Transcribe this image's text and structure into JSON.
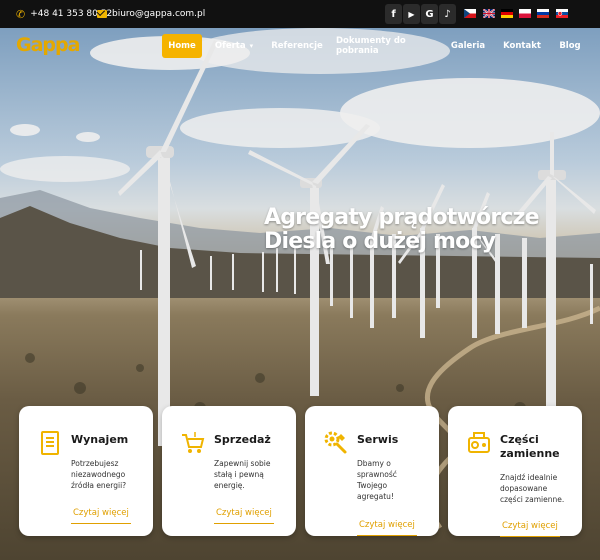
{
  "topbar": {
    "phone": "+48 41 353 80 52",
    "email": "biuro@gappa.com.pl",
    "social": [
      {
        "icon": "facebook-icon",
        "glyph": "f"
      },
      {
        "icon": "youtube-icon",
        "glyph": "▶"
      },
      {
        "icon": "google-icon",
        "glyph": "G"
      },
      {
        "icon": "tiktok-icon",
        "glyph": "♪"
      }
    ],
    "flags": [
      "czech-flag-icon",
      "uk-flag-icon",
      "germany-flag-icon",
      "poland-flag-icon",
      "russia-flag-icon",
      "slovakia-flag-icon"
    ]
  },
  "brand": {
    "logo": "Gappa",
    "accent": "#f5b300"
  },
  "nav": {
    "home": "Home",
    "offer": "Oferta",
    "references": "Referencje",
    "documents": "Dokumenty do pobrania",
    "gallery": "Galeria",
    "contact": "Kontakt",
    "blog": "Blog"
  },
  "hero": {
    "headline": "Agregaty prądotwórcze Diesla o dużej mocy"
  },
  "cards": [
    {
      "title": "Wynajem",
      "text": [
        "Potrzebujesz",
        "niezawodnego",
        "źródła energii?"
      ],
      "link": "Czytaj więcej",
      "icon": "document-icon"
    },
    {
      "title": "Sprzedaż",
      "text": [
        "Zapewnij sobie",
        "stałą i pewną",
        "energię."
      ],
      "link": "Czytaj więcej",
      "icon": "cart-icon"
    },
    {
      "title": "Serwis",
      "text": [
        "Dbamy o",
        "sprawność",
        "Twojego",
        "agregatu!"
      ],
      "link": "Czytaj więcej",
      "icon": "wrench-gear-icon"
    },
    {
      "title": [
        "Części",
        "zamienne"
      ],
      "text": [
        "Znajdź idealnie",
        "dopasowane",
        "części zamienne."
      ],
      "link": "Czytaj więcej",
      "icon": "parts-icon"
    }
  ]
}
